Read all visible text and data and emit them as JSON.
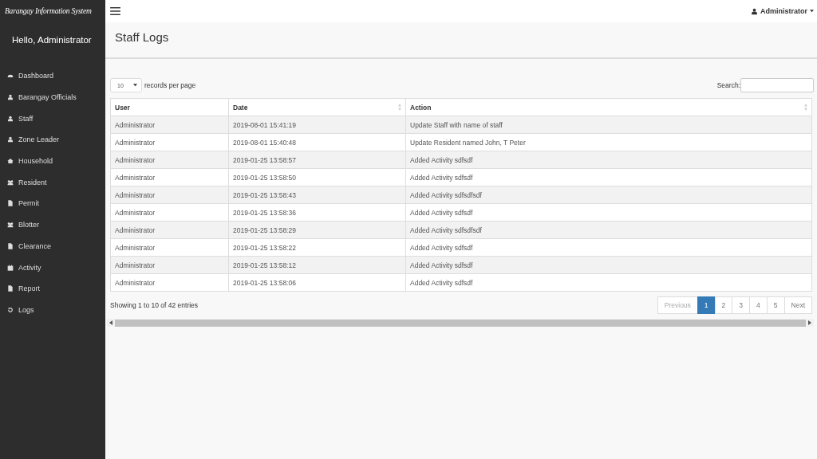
{
  "sidebar": {
    "brand": "Barangay Information System",
    "greeting": "Hello, Administrator",
    "items": [
      {
        "label": "Dashboard",
        "kind": "dashboard"
      },
      {
        "label": "Barangay Officials",
        "kind": "user"
      },
      {
        "label": "Staff",
        "kind": "user"
      },
      {
        "label": "Zone Leader",
        "kind": "user"
      },
      {
        "label": "Household",
        "kind": "home"
      },
      {
        "label": "Resident",
        "kind": "users"
      },
      {
        "label": "Permit",
        "kind": "file"
      },
      {
        "label": "Blotter",
        "kind": "users"
      },
      {
        "label": "Clearance",
        "kind": "file"
      },
      {
        "label": "Activity",
        "kind": "calendar"
      },
      {
        "label": "Report",
        "kind": "file"
      },
      {
        "label": "Logs",
        "kind": "history"
      }
    ]
  },
  "topbar": {
    "user": "Administrator"
  },
  "page_title": "Staff Logs",
  "length_select": {
    "value": "10",
    "label": "records per page"
  },
  "search": {
    "label": "Search:"
  },
  "table": {
    "columns": [
      {
        "label": "User",
        "sortable": false
      },
      {
        "label": "Date",
        "sortable": true
      },
      {
        "label": "Action",
        "sortable": true
      }
    ],
    "rows": [
      [
        "Administrator",
        "2019-08-01 15:41:19",
        "Update Staff with name of staff"
      ],
      [
        "Administrator",
        "2019-08-01 15:40:48",
        "Update Resident named John, T Peter"
      ],
      [
        "Administrator",
        "2019-01-25 13:58:57",
        "Added Activity sdfsdf"
      ],
      [
        "Administrator",
        "2019-01-25 13:58:50",
        "Added Activity sdfsdf"
      ],
      [
        "Administrator",
        "2019-01-25 13:58:43",
        "Added Activity sdfsdfsdf"
      ],
      [
        "Administrator",
        "2019-01-25 13:58:36",
        "Added Activity sdfsdf"
      ],
      [
        "Administrator",
        "2019-01-25 13:58:29",
        "Added Activity sdfsdfsdf"
      ],
      [
        "Administrator",
        "2019-01-25 13:58:22",
        "Added Activity sdfsdf"
      ],
      [
        "Administrator",
        "2019-01-25 13:58:12",
        "Added Activity sdfsdf"
      ],
      [
        "Administrator",
        "2019-01-25 13:58:06",
        "Added Activity sdfsdf"
      ]
    ]
  },
  "info": "Showing 1 to 10 of 42 entries",
  "pagination": {
    "previous": {
      "label": "Previous",
      "disabled": true
    },
    "pages": [
      {
        "label": "1",
        "selected": true
      },
      {
        "label": "2",
        "selected": false
      },
      {
        "label": "3",
        "selected": false
      },
      {
        "label": "4",
        "selected": false
      },
      {
        "label": "5",
        "selected": false
      }
    ],
    "next": {
      "label": "Next",
      "disabled": false
    }
  }
}
